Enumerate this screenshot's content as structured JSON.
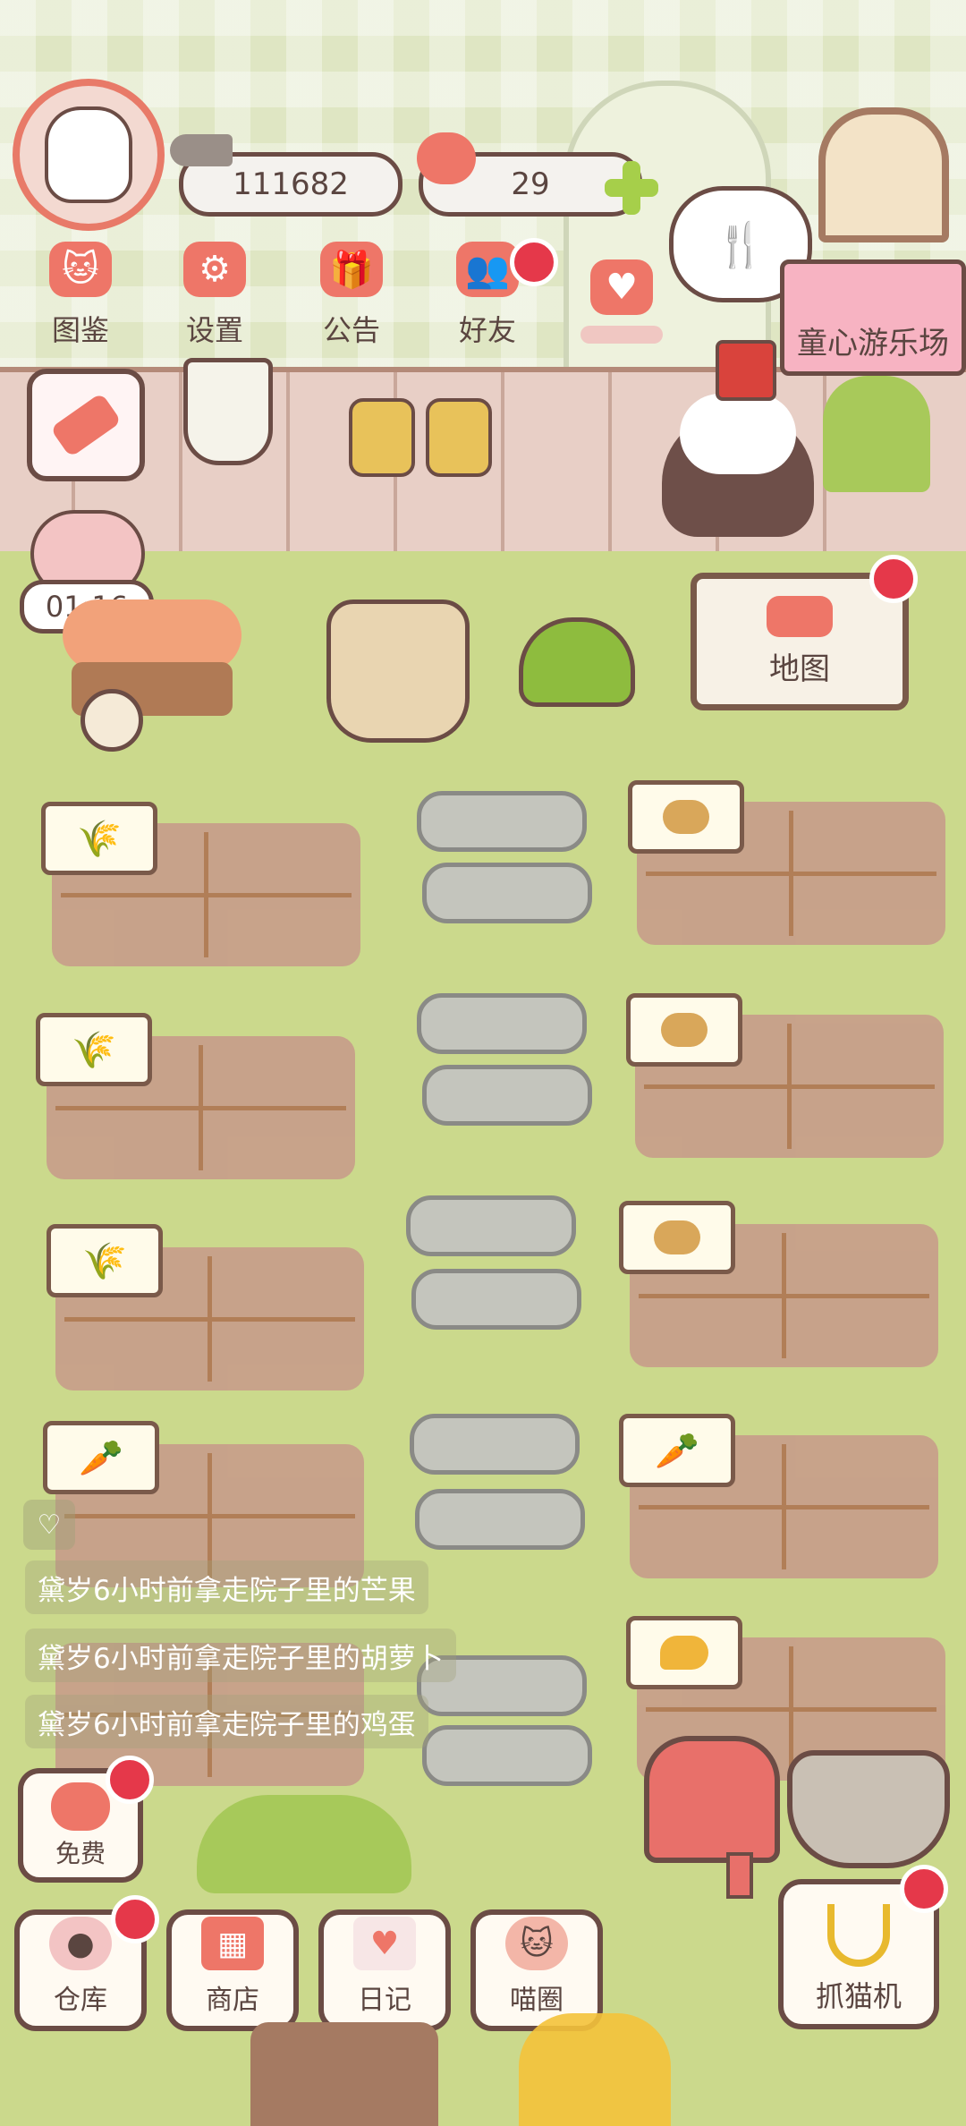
{
  "player": {
    "coins": "111682",
    "hearts": "29"
  },
  "top_menu": [
    {
      "label": "图鉴",
      "icon": "cat-face-icon"
    },
    {
      "label": "设置",
      "icon": "gear-icon"
    },
    {
      "label": "公告",
      "icon": "gift-icon"
    },
    {
      "label": "好友",
      "icon": "friends-icon"
    },
    {
      "label": "",
      "icon": "hearts-icon"
    }
  ],
  "event_banner": {
    "label": "童心游乐场"
  },
  "timer": {
    "value": "01:16"
  },
  "map_sign": {
    "label": "地图"
  },
  "plots": {
    "left_signs": [
      "wheat-icon",
      "wheat-icon",
      "wheat-icon",
      "carrot-icon"
    ],
    "right_signs": [
      "potato-icon",
      "potato-icon",
      "potato-icon",
      "carrot-icon",
      "mango-icon"
    ]
  },
  "feed": [
    {
      "text": "黛岁6小时前拿走院子里的芒果"
    },
    {
      "text": "黛岁6小时前拿走院子里的胡萝卜"
    },
    {
      "text": "黛岁6小时前拿走院子里的鸡蛋"
    }
  ],
  "free_button": {
    "label": "免费"
  },
  "bottom_nav": [
    {
      "label": "仓库",
      "icon": "storage-icon"
    },
    {
      "label": "商店",
      "icon": "shop-icon"
    },
    {
      "label": "日记",
      "icon": "diary-icon"
    },
    {
      "label": "喵圈",
      "icon": "cat-circle-icon"
    }
  ],
  "claw_machine": {
    "label": "抓猫机"
  },
  "colors": {
    "accent": "#ee7668",
    "badge": "#e5384a",
    "outline": "#6b4c45",
    "grass": "#cbd98c"
  }
}
